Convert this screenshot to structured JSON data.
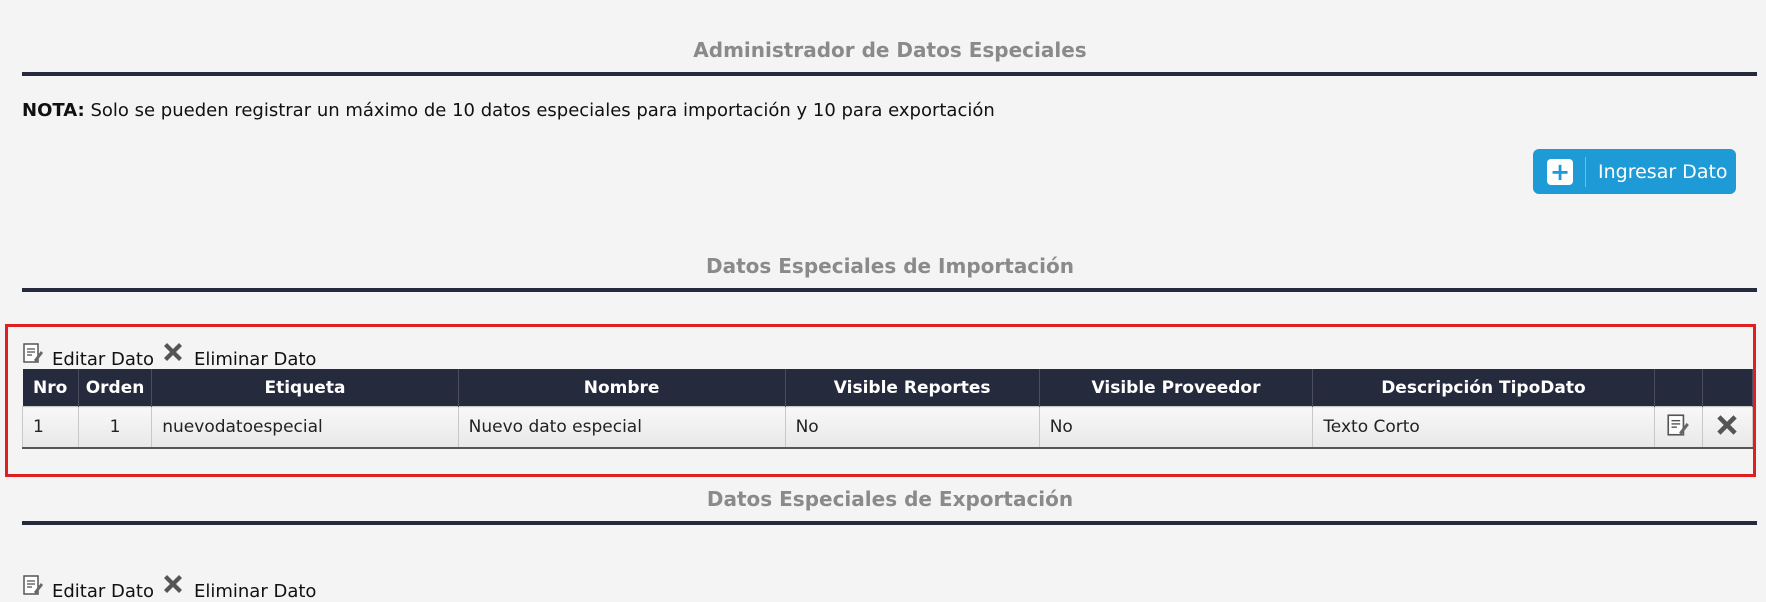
{
  "admin": {
    "title": "Administrador de Datos Especiales",
    "nota_label": "NOTA:",
    "nota_text": "Solo se pueden registrar un máximo de 10 datos especiales para importación y 10 para exportación",
    "add_button_label": "Ingresar Dato"
  },
  "importacion": {
    "title": "Datos Especiales de Importación",
    "toolbar": {
      "edit_label": "Editar Dato",
      "delete_label": "Eliminar Dato"
    },
    "columns": [
      "Nro",
      "Orden",
      "Etiqueta",
      "Nombre",
      "Visible Reportes",
      "Visible Proveedor",
      "Descripción TipoDato"
    ],
    "rows": [
      {
        "nro": "1",
        "orden": "1",
        "etiqueta": "nuevodatoespecial",
        "nombre": "Nuevo dato especial",
        "visible_reportes": "No",
        "visible_proveedor": "No",
        "descripcion_tipodato": "Texto Corto"
      }
    ]
  },
  "exportacion": {
    "title": "Datos Especiales de Exportación",
    "toolbar": {
      "edit_label": "Editar Dato",
      "delete_label": "Eliminar Dato"
    }
  },
  "icons": {
    "edit": "edit-document-icon",
    "delete": "x-delete-icon",
    "add": "plus-icon"
  },
  "colors": {
    "accent": "#1e9bd7",
    "header": "#262a3d",
    "highlight": "#e02020",
    "title": "#8a8a8a"
  }
}
